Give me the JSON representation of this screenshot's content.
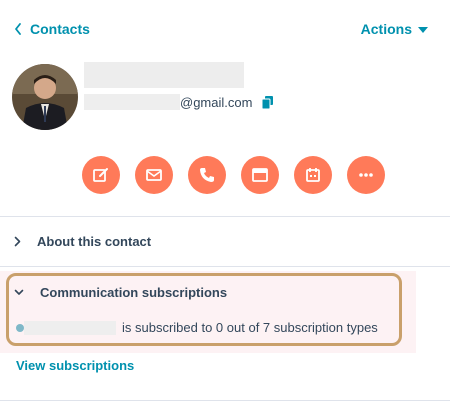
{
  "header": {
    "back_label": "Contacts",
    "actions_label": "Actions"
  },
  "contact": {
    "email_suffix": "@gmail.com"
  },
  "action_buttons": [
    {
      "icon": "note-edit-icon"
    },
    {
      "icon": "email-icon"
    },
    {
      "icon": "phone-icon"
    },
    {
      "icon": "log-activity-icon"
    },
    {
      "icon": "calendar-icon"
    },
    {
      "icon": "more-icon"
    }
  ],
  "sections": {
    "about_label": "About this contact",
    "comm_label": "Communication subscriptions",
    "subscription_status": "is subscribed to 0 out of 7 subscription types",
    "view_link": "View subscriptions"
  },
  "colors": {
    "accent": "#0091ae",
    "action_button": "#ff7a59",
    "highlight_border": "#c9a06b"
  }
}
